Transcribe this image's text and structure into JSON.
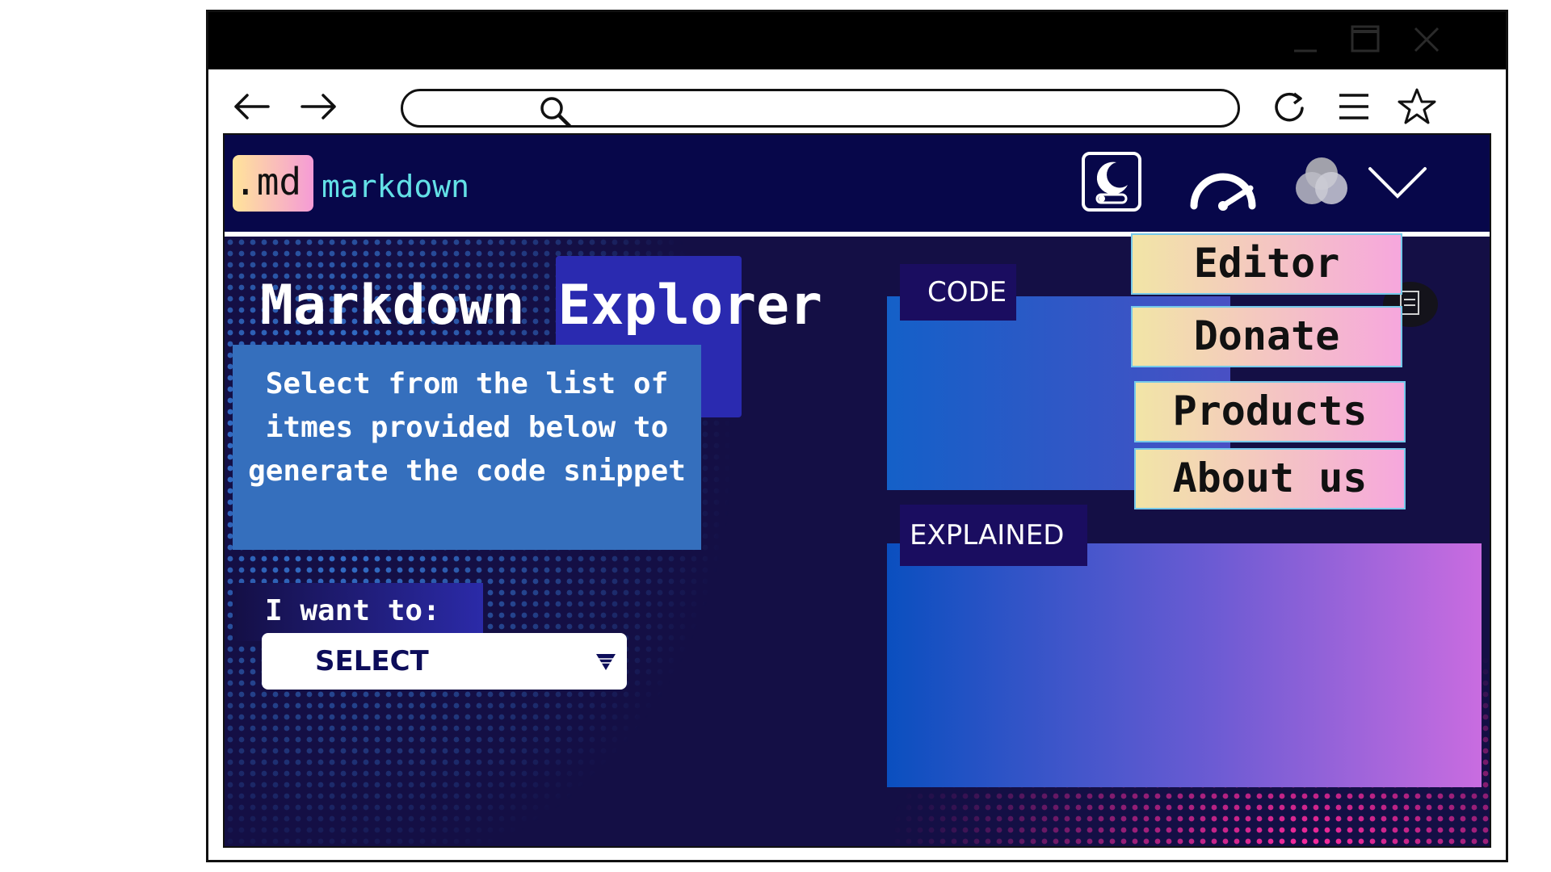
{
  "browser": {
    "window_controls": {
      "minimize": "minimize-icon",
      "maximize": "maximize-icon",
      "close": "close-icon"
    },
    "toolbar": {
      "back": "back-arrow-icon",
      "forward": "forward-arrow-icon",
      "search": "search-icon",
      "reload": "reload-icon",
      "menu": "hamburger-menu-icon",
      "bookmark": "star-icon"
    },
    "address_value": ""
  },
  "app": {
    "logo_badge": ".md",
    "brand": "markdown",
    "icons": [
      "theme-toggle-icon",
      "speedometer-icon",
      "color-palette-icon",
      "chevron-down-icon"
    ],
    "colors": {
      "appbar": "#07074a",
      "brand": "#63e0e6",
      "accent_magenta": "#ff2fa0",
      "accent_blue": "#2f8df0"
    }
  },
  "hero": {
    "title": "Markdown Explorer",
    "description": "Select from the list of itmes provided below to generate the code snippet",
    "want_label": "I want to:",
    "select_value": "SELECT"
  },
  "panels": {
    "code_label": "CODE",
    "explained_label": "EXPLAINED"
  },
  "menu": {
    "items": [
      {
        "label": "Editor"
      },
      {
        "label": "Donate"
      },
      {
        "label": "Products"
      },
      {
        "label": "About us"
      }
    ],
    "behind_icon": "document-icon"
  }
}
